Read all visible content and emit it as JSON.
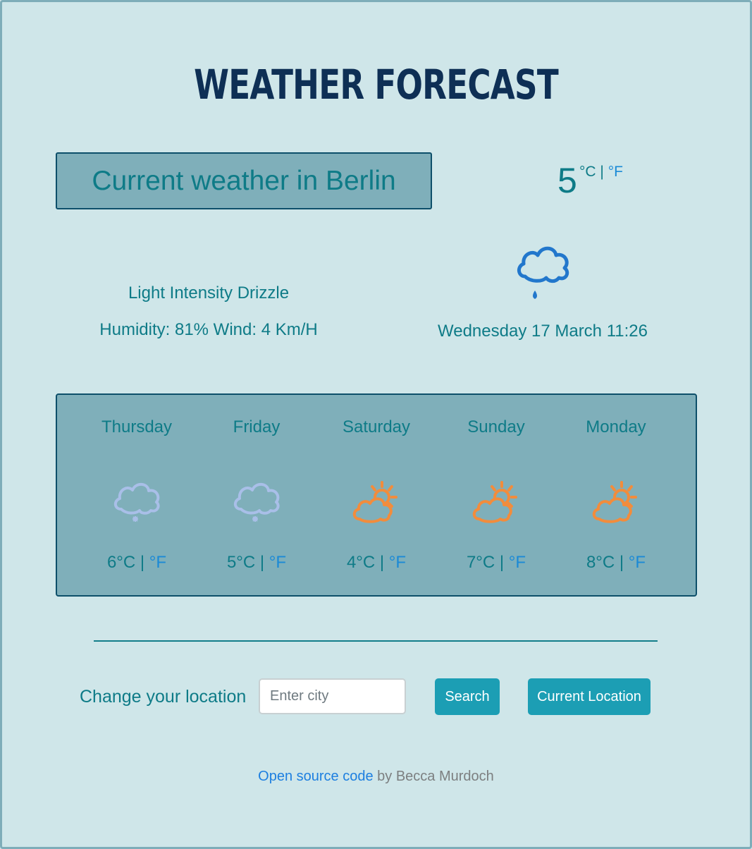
{
  "header": {
    "title": "WEATHER FORECAST"
  },
  "current": {
    "heading": "Current weather in Berlin",
    "temperature": "5",
    "unit_c": "°C",
    "unit_separator": "|",
    "unit_f": "°F",
    "description": "Light Intensity Drizzle",
    "humidity_wind": "Humidity: 81% Wind: 4 Km/H",
    "datetime": "Wednesday 17 March 11:26",
    "icon": "drizzle-cloud-icon"
  },
  "forecast": [
    {
      "day": "Thursday",
      "temp": "6°C",
      "sep": "|",
      "unit_f": "°F",
      "icon": "snow-cloud-icon"
    },
    {
      "day": "Friday",
      "temp": "5°C",
      "sep": "|",
      "unit_f": "°F",
      "icon": "snow-cloud-icon"
    },
    {
      "day": "Saturday",
      "temp": "4°C",
      "sep": "|",
      "unit_f": "°F",
      "icon": "partly-sunny-icon"
    },
    {
      "day": "Sunday",
      "temp": "7°C",
      "sep": "|",
      "unit_f": "°F",
      "icon": "partly-sunny-icon"
    },
    {
      "day": "Monday",
      "temp": "8°C",
      "sep": "|",
      "unit_f": "°F",
      "icon": "partly-sunny-icon"
    }
  ],
  "search": {
    "label": "Change your location",
    "placeholder": "Enter city",
    "search_button": "Search",
    "current_location_button": "Current Location"
  },
  "footer": {
    "link_text": "Open source code",
    "by_text": " by Becca Murdoch"
  },
  "colors": {
    "background": "#cfe6e9",
    "panel": "#7fafba",
    "title": "#0e2f55",
    "text": "#0e7b87",
    "accent": "#1c9eb4",
    "fahrenheit": "#1b8ad6",
    "snow_icon": "#a9bfe8",
    "sun_icon": "#f28c3c",
    "drizzle_icon": "#2277cc"
  }
}
